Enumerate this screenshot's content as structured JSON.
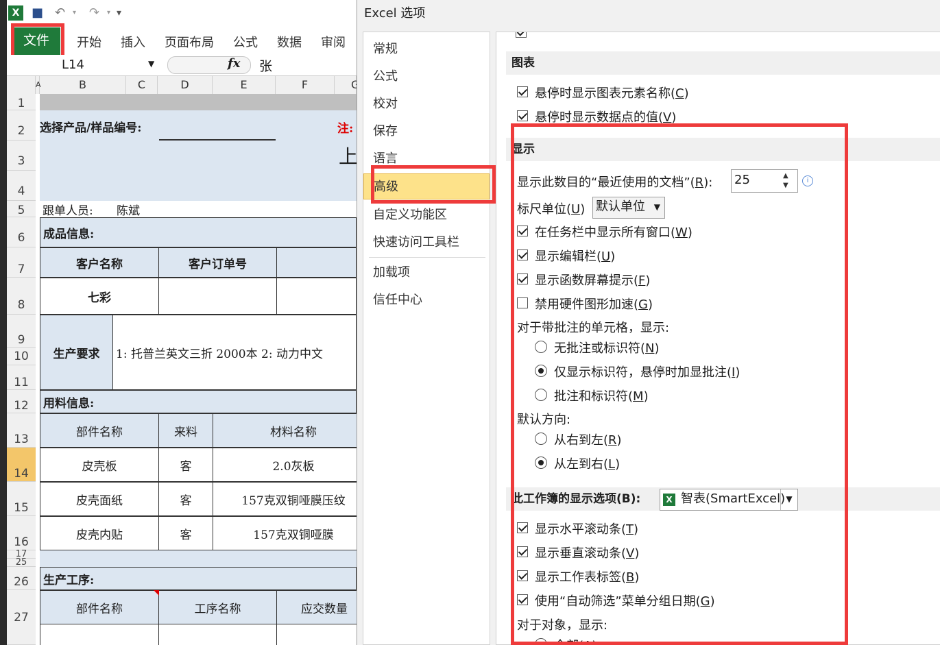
{
  "excel": {
    "ribbon_tabs": [
      "开始",
      "插入",
      "页面布局",
      "公式",
      "数据",
      "审阅"
    ],
    "file_tab": "文件",
    "name_box": "L14",
    "formula_value": "张",
    "fx_label": "fx",
    "columns": [
      "A",
      "B",
      "C",
      "D",
      "E",
      "F",
      "G"
    ],
    "rows": [
      "1",
      "2",
      "3",
      "4",
      "5",
      "6",
      "7",
      "8",
      "9",
      "10",
      "11",
      "12",
      "13",
      "14",
      "15",
      "16",
      "17",
      "25",
      "26",
      "27"
    ],
    "active_row": "14",
    "sheet": {
      "select_product_label": "选择产品/样品编号:",
      "note_label": "注:",
      "title_partial": "上",
      "follower_label": "跟单人员:",
      "follower_name": "陈斌",
      "product_info": "成品信息:",
      "customer_name_hdr": "客户名称",
      "customer_order_hdr": "客户订单号",
      "customer_name_val": "七彩",
      "production_req_label": "生产要求",
      "production_req_text": "1: 托普兰英文三折 2000本    2: 动力中文",
      "material_info": "用料信息:",
      "part_name_hdr": "部件名称",
      "source_hdr": "来料",
      "material_name_hdr": "材料名称",
      "materials": [
        {
          "part": "皮壳板",
          "source": "客",
          "material": "2.0灰板"
        },
        {
          "part": "皮壳面纸",
          "source": "客",
          "material": "157克双铜哑膜压纹"
        },
        {
          "part": "皮壳内贴",
          "source": "客",
          "material": "157克双铜哑膜"
        }
      ],
      "process_label": "生产工序:",
      "process_part_hdr": "部件名称",
      "process_name_hdr": "工序名称",
      "due_qty_hdr": "应交数量"
    }
  },
  "dialog": {
    "title": "Excel 选项",
    "nav": [
      "常规",
      "公式",
      "校对",
      "保存",
      "语言",
      "高级",
      "自定义功能区",
      "快速访问工具栏",
      "加载项",
      "信任中心"
    ],
    "selected_nav": "高级",
    "sections": {
      "chart": "图表",
      "display": "显示",
      "workbook": "此工作簿的显示选项(B):"
    },
    "chart_options": [
      {
        "label": "悬停时显示图表元素名称(",
        "key": "C",
        "checked": true
      },
      {
        "label": "悬停时显示数据点的值(",
        "key": "V",
        "checked": true
      }
    ],
    "recent_docs_label": "显示此数目的“最近使用的文档”(",
    "recent_docs_key": "R",
    "recent_docs_value": "25",
    "ruler_label": "标尺单位(",
    "ruler_key": "U",
    "ruler_value": "默认单位",
    "display_checks": [
      {
        "label": "在任务栏中显示所有窗口(",
        "key": "W",
        "checked": true
      },
      {
        "label": "显示编辑栏(",
        "key": "U",
        "checked": true
      },
      {
        "label": "显示函数屏幕提示(",
        "key": "F",
        "checked": true
      },
      {
        "label": "禁用硬件图形加速(",
        "key": "G",
        "checked": false
      }
    ],
    "comments_label": "对于带批注的单元格，显示:",
    "comment_radios": [
      {
        "label": "无批注或标识符(",
        "key": "N",
        "selected": false
      },
      {
        "label": "仅显示标识符，悬停时加显批注(",
        "key": "I",
        "selected": true
      },
      {
        "label": "批注和标识符(",
        "key": "M",
        "selected": false
      }
    ],
    "direction_label": "默认方向:",
    "direction_radios": [
      {
        "label": "从右到左(",
        "key": "R",
        "selected": false
      },
      {
        "label": "从左到右(",
        "key": "L",
        "selected": true
      }
    ],
    "workbook_value": "智表(SmartExcel)",
    "workbook_checks": [
      {
        "label": "显示水平滚动条(",
        "key": "T",
        "checked": true
      },
      {
        "label": "显示垂直滚动条(",
        "key": "V",
        "checked": true
      },
      {
        "label": "显示工作表标签(",
        "key": "B",
        "checked": true
      },
      {
        "label": "使用“自动筛选”菜单分组日期(",
        "key": "G",
        "checked": true
      }
    ],
    "objects_label": "对于对象，显示:",
    "objects_first": "全部(",
    "objects_first_key": "A",
    "close_paren": ")"
  },
  "colors": {
    "file_tab": "#1f7a3a",
    "highlight_red": "#ee3b3b",
    "nav_selected": "#fde28a",
    "active_row": "#f3c66a",
    "section_blue": "#dce6f1"
  }
}
